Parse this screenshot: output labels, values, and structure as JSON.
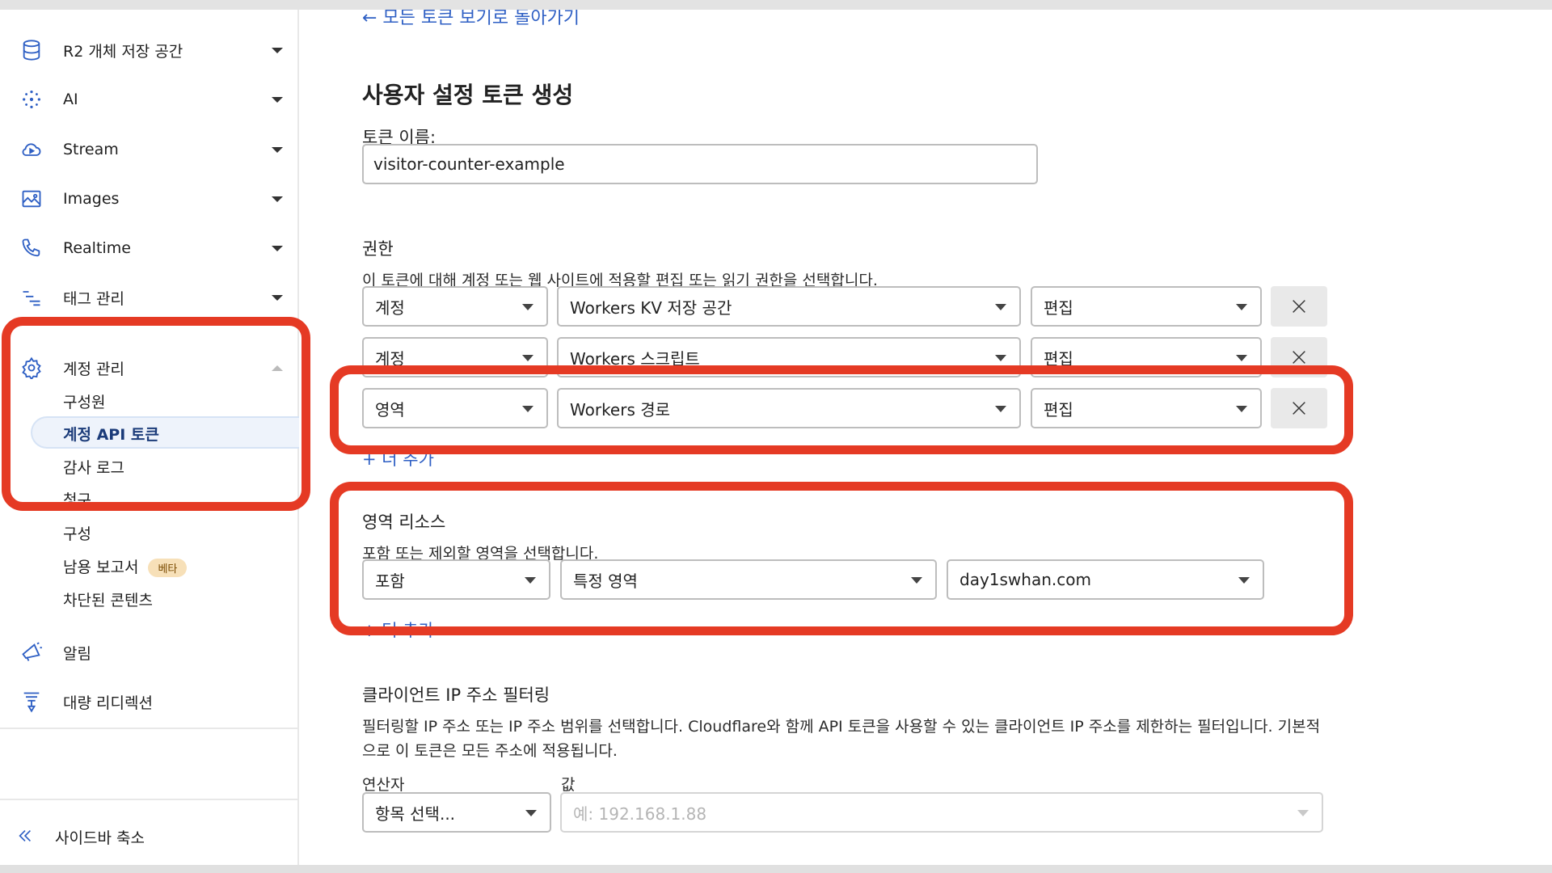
{
  "sidebar": {
    "items": [
      {
        "label": "R2 개체 저장 공간",
        "icon": "database-icon"
      },
      {
        "label": "AI",
        "icon": "sparkle-icon"
      },
      {
        "label": "Stream",
        "icon": "cloud-play-icon"
      },
      {
        "label": "Images",
        "icon": "image-icon"
      },
      {
        "label": "Realtime",
        "icon": "phone-icon"
      },
      {
        "label": "태그 관리",
        "icon": "list-icon"
      },
      {
        "label": "계정 관리",
        "icon": "gear-icon"
      }
    ],
    "sub_items": {
      "members": "구성원",
      "api_tokens": "계정 API 토큰",
      "audit_log": "감사 로그",
      "billing_clipped": "청구",
      "config": "구성",
      "abuse_reports": "남용 보고서",
      "abuse_badge": "베타",
      "blocked_content": "차단된 콘텐츠"
    },
    "bottom_items": [
      {
        "label": "알림",
        "icon": "megaphone-icon"
      },
      {
        "label": "대량 리디렉션",
        "icon": "funnel-icon"
      }
    ],
    "collapse_label": "사이드바 축소"
  },
  "main": {
    "back_link": "← 모든 토큰 보기로 돌아가기",
    "title": "사용자 설정 토큰 생성",
    "token_name_label": "토큰 이름:",
    "token_name_value": "visitor-counter-example",
    "permissions": {
      "heading": "권한",
      "help": "이 토큰에 대해 계정 또는 웹 사이트에 적용할 편집 또는 읽기 권한을 선택합니다.",
      "rows": [
        {
          "scope": "계정",
          "resource": "Workers KV 저장 공간",
          "level": "편집"
        },
        {
          "scope": "계정",
          "resource": "Workers 스크립트",
          "level": "편집"
        },
        {
          "scope": "영역",
          "resource": "Workers 경로",
          "level": "편집"
        }
      ],
      "add_more": "+ 더 추가"
    },
    "zone_resources": {
      "heading": "영역 리소스",
      "help": "포함 또는 제외할 영역을 선택합니다.",
      "include": "포함",
      "zone_type": "특정 영역",
      "zone": "day1swhan.com",
      "add_more": "+ 더 추가"
    },
    "ip_filter": {
      "heading": "클라이언트 IP 주소 필터링",
      "help_line1": "필터링할 IP 주소 또는 IP 주소 범위를 선택합니다. Cloudflare와 함께 API 토큰을 사용할 수 있는 클라이언트 IP 주소를 제한하는 필터입니다. 기본적",
      "help_line2": "으로 이 토큰은 모든 주소에 적용됩니다.",
      "operator_label": "연산자",
      "value_label": "값",
      "operator_placeholder": "항목 선택...",
      "value_placeholder": "예: 192.168.1.88"
    }
  },
  "colors": {
    "highlight": "#e53a24",
    "link": "#2e5fc4",
    "active_text": "#1b3b79"
  }
}
